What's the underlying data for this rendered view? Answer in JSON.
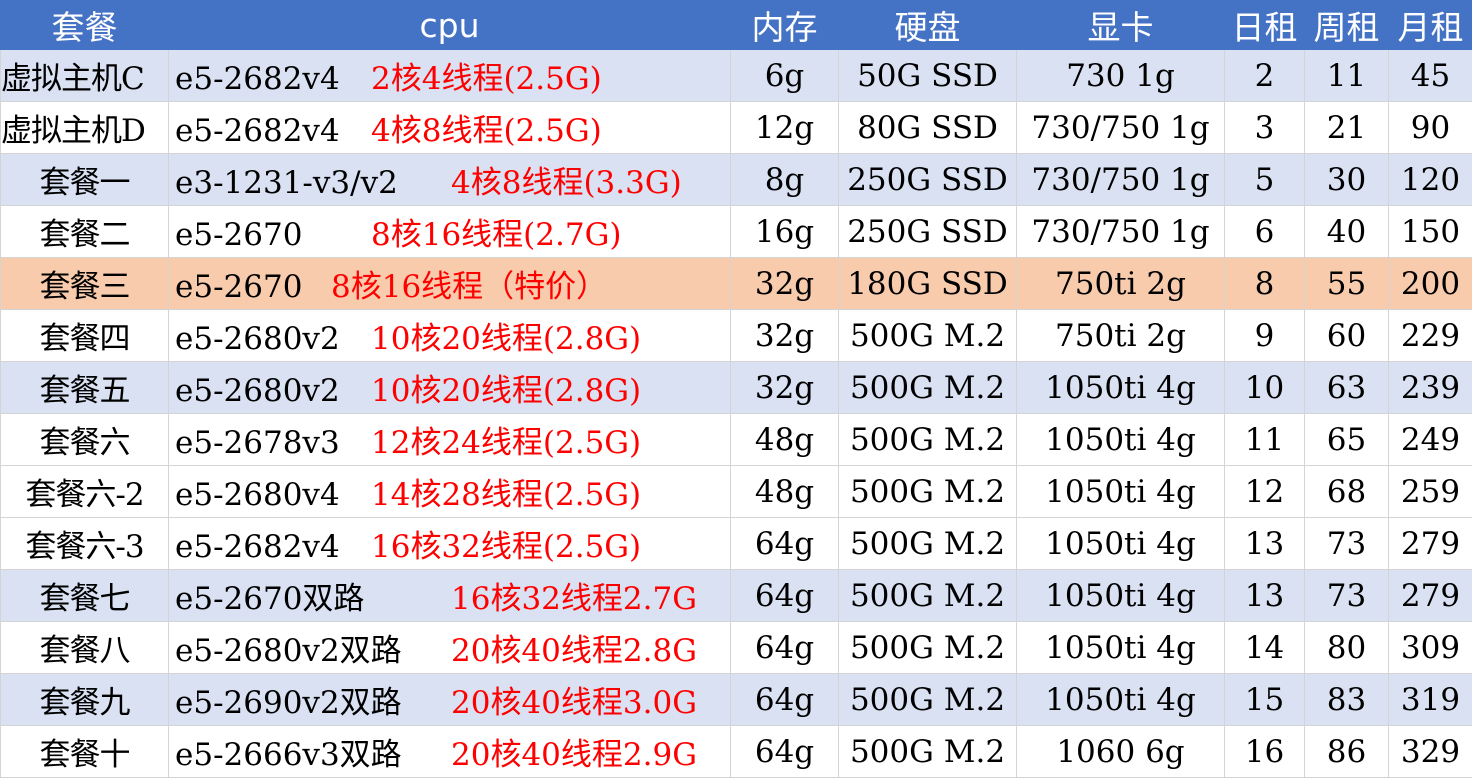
{
  "headers": [
    "套餐",
    "cpu",
    "内存",
    "硬盘",
    "显卡",
    "日租",
    "周租",
    "月租"
  ],
  "rows": [
    {
      "pkg": "虚拟主机C",
      "cpu": "e5-2682v4",
      "spec": "2核4线程(2.5G)",
      "mem": "6g",
      "disk": "50G SSD",
      "gpu": "730 1g",
      "day": "2",
      "week": "11",
      "month": "45"
    },
    {
      "pkg": "虚拟主机D",
      "cpu": "e5-2682v4",
      "spec": "4核8线程(2.5G)",
      "mem": "12g",
      "disk": "80G SSD",
      "gpu": "730/750 1g",
      "day": "3",
      "week": "21",
      "month": "90"
    },
    {
      "pkg": "套餐一",
      "cpu": "e3-1231-v3/v2",
      "spec": "4核8线程(3.3G)",
      "mem": "8g",
      "disk": "250G SSD",
      "gpu": "730/750 1g",
      "day": "5",
      "week": "30",
      "month": "120"
    },
    {
      "pkg": "套餐二",
      "cpu": "e5-2670",
      "spec": "8核16线程(2.7G)",
      "mem": "16g",
      "disk": "250G SSD",
      "gpu": "730/750 1g",
      "day": "6",
      "week": "40",
      "month": "150"
    },
    {
      "pkg": "套餐三",
      "cpu": "e5-2670",
      "spec": "8核16线程（特价）",
      "mem": "32g",
      "disk": "180G SSD",
      "gpu": "750ti 2g",
      "day": "8",
      "week": "55",
      "month": "200"
    },
    {
      "pkg": "套餐四",
      "cpu": "e5-2680v2",
      "spec": "10核20线程(2.8G)",
      "mem": "32g",
      "disk": "500G M.2",
      "gpu": "750ti 2g",
      "day": "9",
      "week": "60",
      "month": "229"
    },
    {
      "pkg": "套餐五",
      "cpu": "e5-2680v2",
      "spec": "10核20线程(2.8G)",
      "mem": "32g",
      "disk": "500G M.2",
      "gpu": "1050ti 4g",
      "day": "10",
      "week": "63",
      "month": "239"
    },
    {
      "pkg": "套餐六",
      "cpu": "e5-2678v3",
      "spec": "12核24线程(2.5G)",
      "mem": "48g",
      "disk": "500G M.2",
      "gpu": "1050ti 4g",
      "day": "11",
      "week": "65",
      "month": "249"
    },
    {
      "pkg": "套餐六-2",
      "cpu": "e5-2680v4",
      "spec": "14核28线程(2.5G)",
      "mem": "48g",
      "disk": "500G M.2",
      "gpu": "1050ti 4g",
      "day": "12",
      "week": "68",
      "month": "259"
    },
    {
      "pkg": "套餐六-3",
      "cpu": "e5-2682v4",
      "spec": "16核32线程(2.5G)",
      "mem": "64g",
      "disk": "500G M.2",
      "gpu": "1050ti 4g",
      "day": "13",
      "week": "73",
      "month": "279"
    },
    {
      "pkg": "套餐七",
      "cpu": "e5-2670双路",
      "spec": "16核32线程2.7G",
      "mem": "64g",
      "disk": "500G M.2",
      "gpu": "1050ti 4g",
      "day": "13",
      "week": "73",
      "month": "279"
    },
    {
      "pkg": "套餐八",
      "cpu": "e5-2680v2双路",
      "spec": "20核40线程2.8G",
      "mem": "64g",
      "disk": "500G M.2",
      "gpu": "1050ti 4g",
      "day": "14",
      "week": "80",
      "month": "309"
    },
    {
      "pkg": "套餐九",
      "cpu": "e5-2690v2双路",
      "spec": "20核40线程3.0G",
      "mem": "64g",
      "disk": "500G M.2",
      "gpu": "1050ti 4g",
      "day": "15",
      "week": "83",
      "month": "319"
    },
    {
      "pkg": "套餐十",
      "cpu": "e5-2666v3双路",
      "spec": "20核40线程2.9G",
      "mem": "64g",
      "disk": "500G M.2",
      "gpu": "1060 6g",
      "day": "16",
      "week": "86",
      "month": "329"
    }
  ],
  "colors": {
    "header": "#4472c4",
    "band": "#d9e1f2",
    "highlight": "#f8cbad",
    "spec_text": "#ff0000"
  }
}
